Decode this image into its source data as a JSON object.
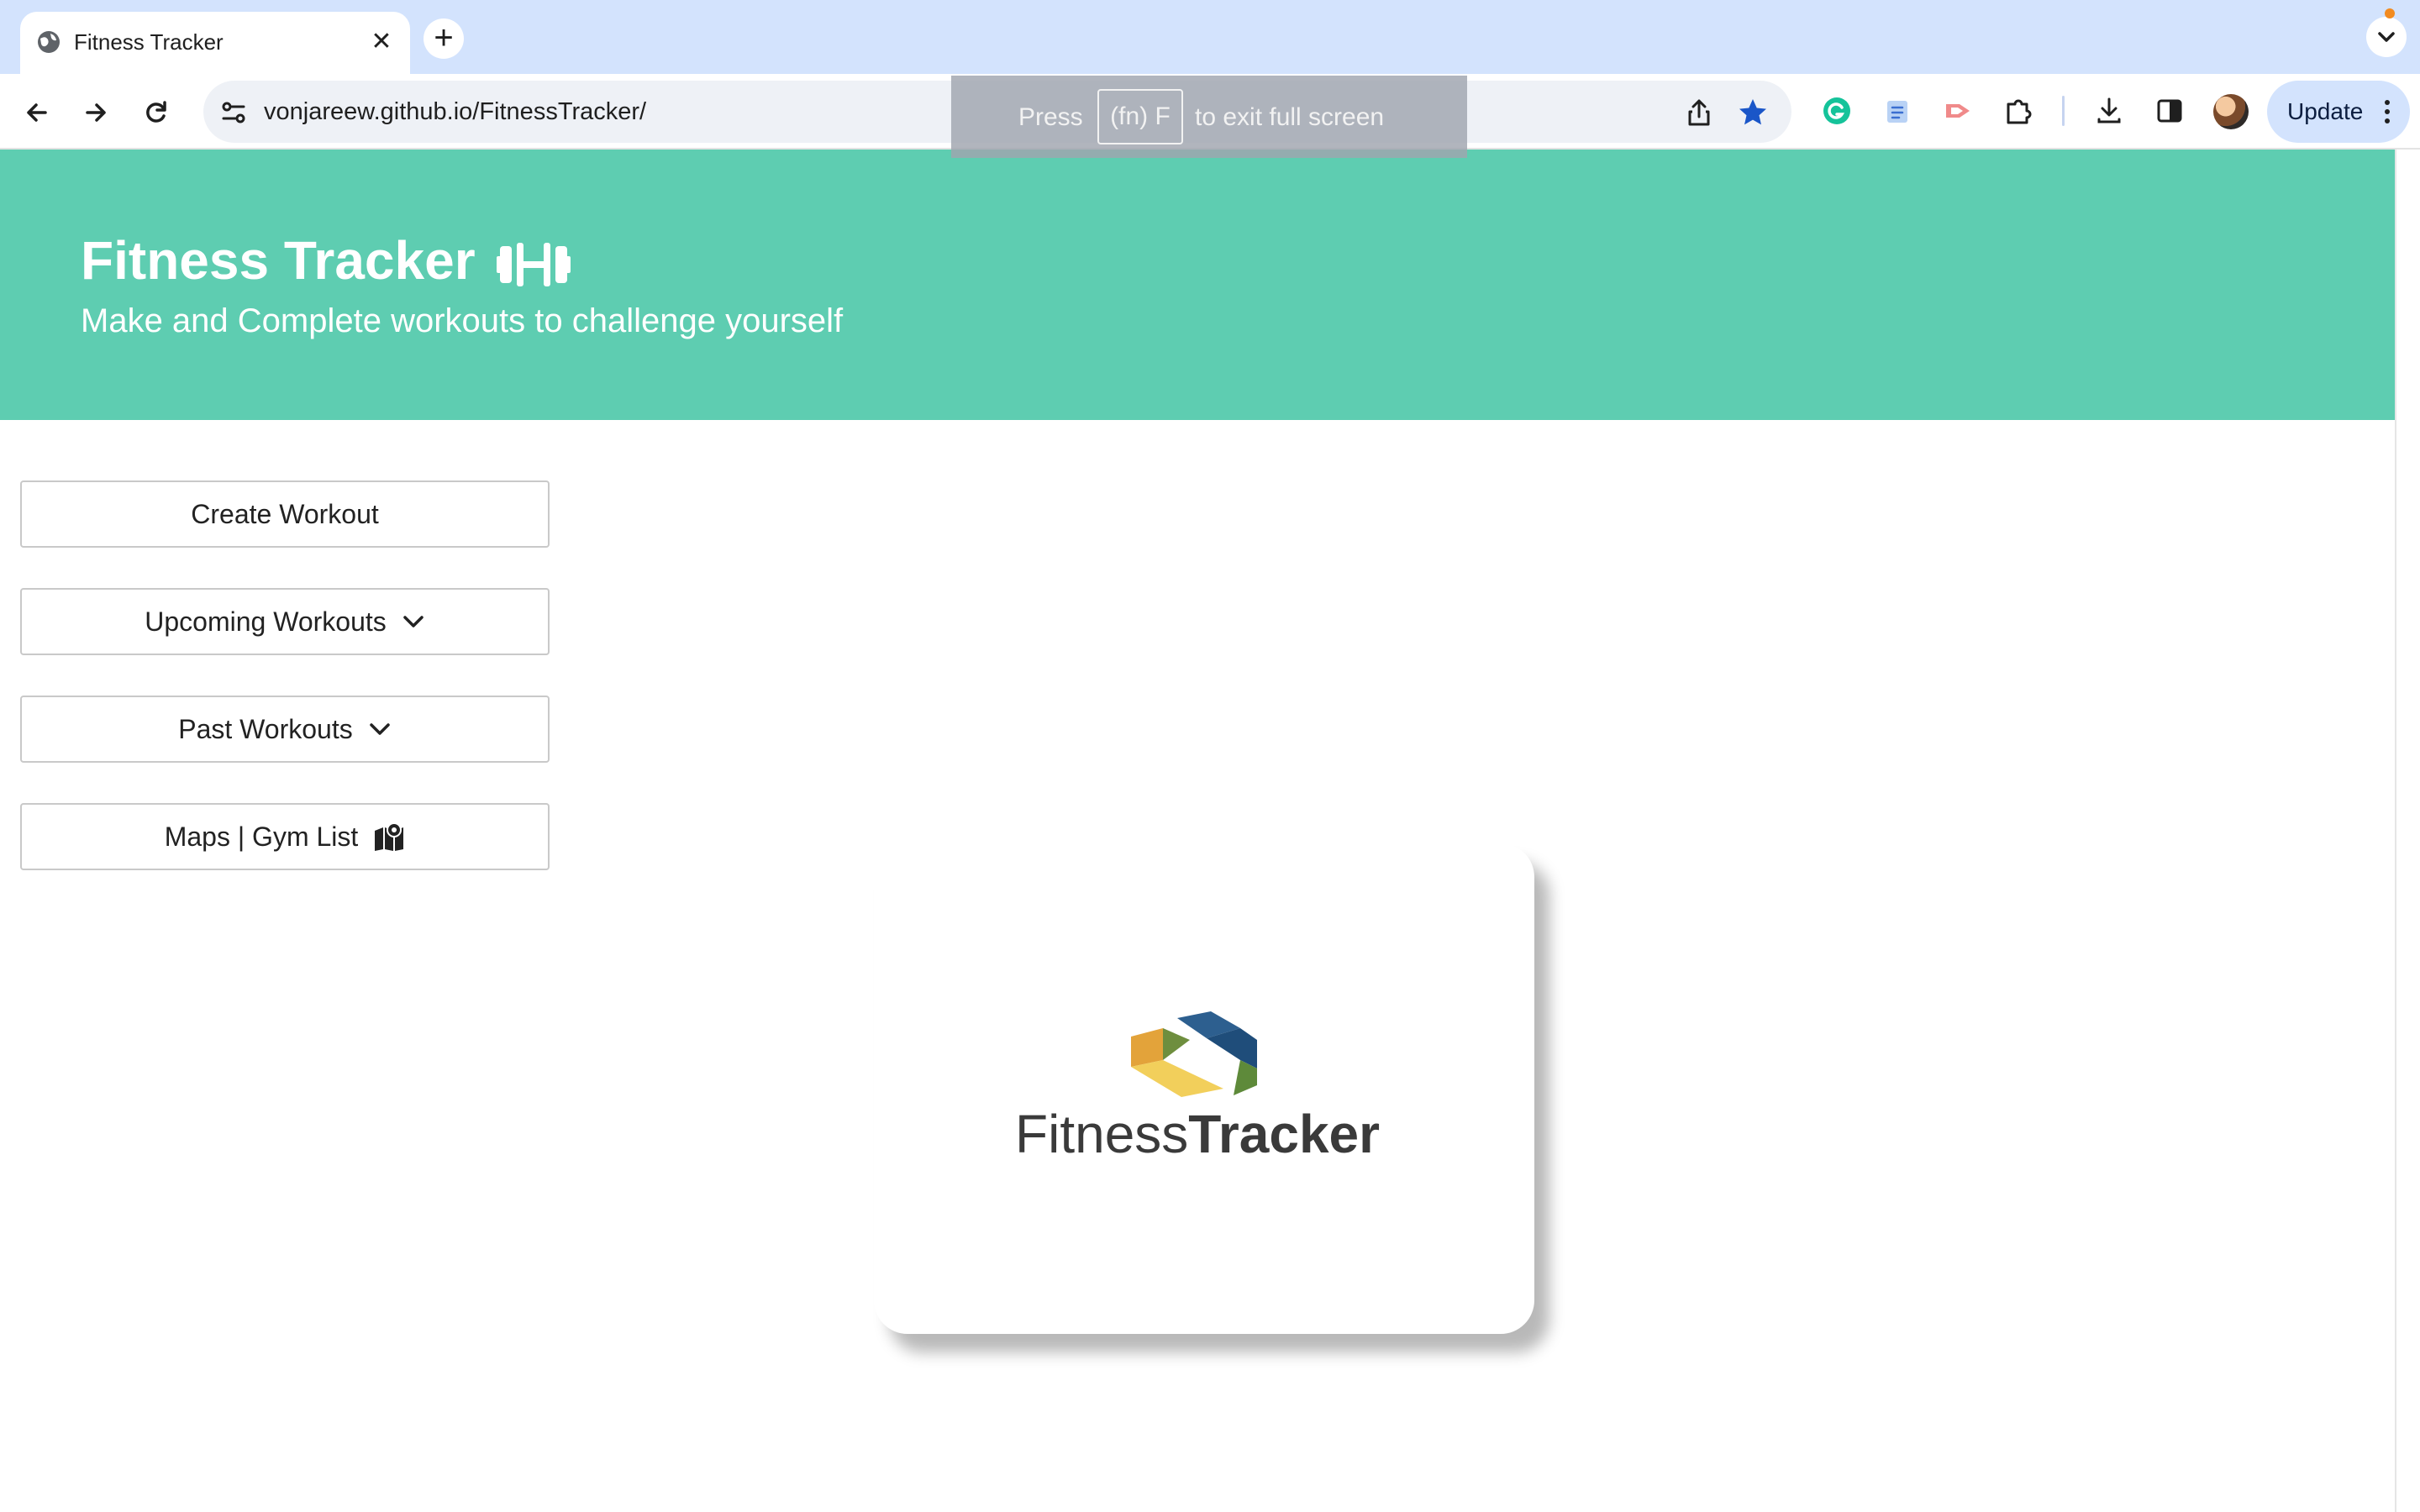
{
  "browser": {
    "tab_title": "Fitness Tracker",
    "url": "vonjareew.github.io/FitnessTracker/",
    "update_label": "Update",
    "fullscreen_notice": {
      "press": "Press",
      "key": "(fn) F",
      "rest": "to exit full screen"
    },
    "icons": [
      "globe-icon",
      "close-icon",
      "plus-icon",
      "chevron-down-icon",
      "back-arrow-icon",
      "forward-arrow-icon",
      "reload-icon",
      "site-settings-icon",
      "share-icon",
      "star-icon",
      "grammarly-icon",
      "extension-icon",
      "puzzle-icon",
      "download-icon",
      "side-panel-icon",
      "avatar",
      "more-vert-icon"
    ],
    "colors": {
      "tabstrip": "#d3e3fd",
      "star": "#1a56c8"
    }
  },
  "header": {
    "title": "Fitness Tracker",
    "subtitle": "Make and Complete workouts to challenge yourself",
    "icon": "dumbbell-icon",
    "background": "#5ecdb1"
  },
  "sidebar": {
    "create_label": "Create Workout",
    "upcoming_label": "Upcoming Workouts",
    "past_label": "Past Workouts",
    "maps_label": "Maps | Gym List"
  },
  "logo": {
    "word_light": "Fitness",
    "word_bold": "Tracker"
  }
}
